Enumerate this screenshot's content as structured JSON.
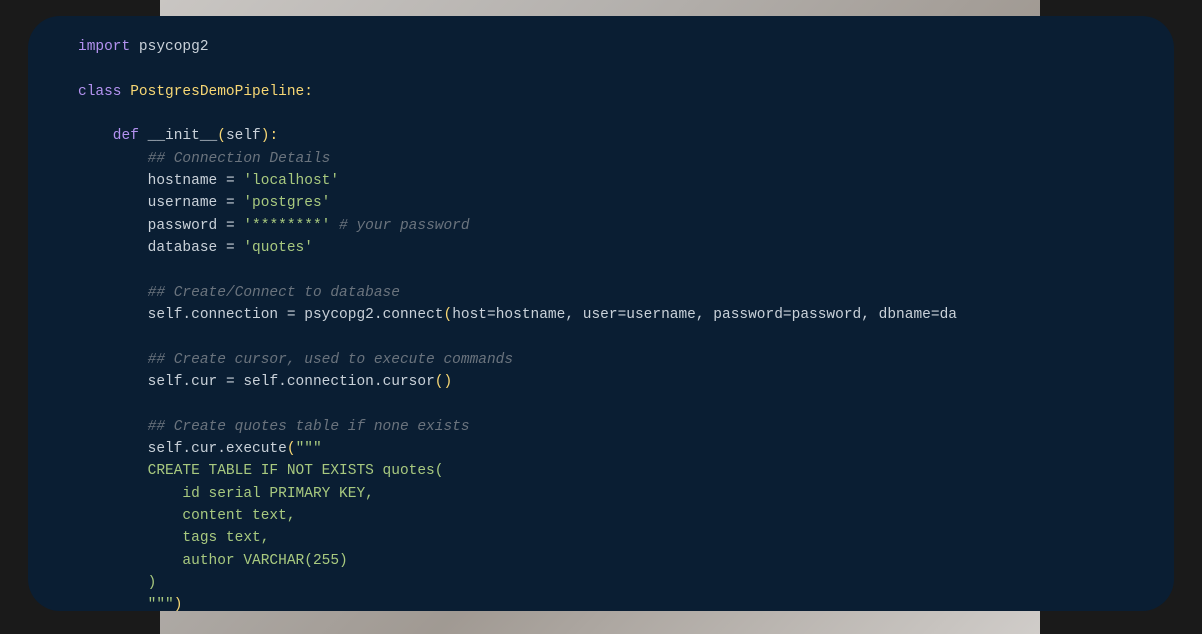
{
  "code": {
    "line1_import": "import",
    "line1_module": " psycopg2",
    "line3_class": "class",
    "line3_classname": " PostgresDemoPipeline",
    "line3_colon": ":",
    "line5_def": "    def",
    "line5_funcname": " __init__",
    "line5_open": "(",
    "line5_self": "self",
    "line5_close": ")",
    "line5_colon": ":",
    "line6_comment": "        ## Connection Details",
    "line7_var": "        hostname ",
    "line7_op": "=",
    "line7_str": " 'localhost'",
    "line8_var": "        username ",
    "line8_op": "=",
    "line8_str": " 'postgres'",
    "line9_var": "        password ",
    "line9_op": "=",
    "line9_str": " '********'",
    "line9_comment": " # your password",
    "line10_var": "        database ",
    "line10_op": "=",
    "line10_str": " 'quotes'",
    "line12_comment": "        ## Create/Connect to database",
    "line13_a": "        self",
    "line13_b": ".connection ",
    "line13_c": "=",
    "line13_d": " psycopg2",
    "line13_e": ".connect",
    "line13_f": "(",
    "line13_g": "host",
    "line13_h": "=",
    "line13_i": "hostname",
    "line13_j": ", ",
    "line13_k": "user",
    "line13_l": "=",
    "line13_m": "username",
    "line13_n": ", ",
    "line13_o": "password",
    "line13_p": "=",
    "line13_q": "password",
    "line13_r": ", ",
    "line13_s": "dbname",
    "line13_t": "=",
    "line13_u": "da",
    "line15_comment": "        ## Create cursor, used to execute commands",
    "line16_a": "        self",
    "line16_b": ".cur ",
    "line16_c": "=",
    "line16_d": " self",
    "line16_e": ".connection",
    "line16_f": ".cursor",
    "line16_g": "(",
    "line16_h": ")",
    "line18_comment": "        ## Create quotes table if none exists",
    "line19_a": "        self",
    "line19_b": ".cur",
    "line19_c": ".execute",
    "line19_d": "(",
    "line19_e": "\"\"\"",
    "line20": "        CREATE TABLE IF NOT EXISTS quotes(",
    "line21": "            id serial PRIMARY KEY, ",
    "line22": "            content text,",
    "line23": "            tags text,",
    "line24": "            author VARCHAR(255)",
    "line25": "        )",
    "line26_a": "        \"\"\"",
    "line26_b": ")"
  }
}
